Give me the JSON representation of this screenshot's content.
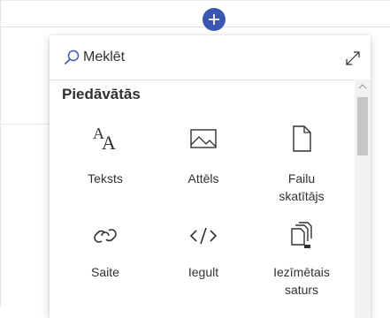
{
  "search": {
    "placeholder": "Meklēt"
  },
  "section": {
    "title": "Piedāvātās"
  },
  "tiles": [
    {
      "label": "Teksts",
      "icon": "text-icon"
    },
    {
      "label": "Attēls",
      "icon": "image-icon"
    },
    {
      "label": "Failu skatītājs",
      "icon": "file-viewer-icon"
    },
    {
      "label": "Saite",
      "icon": "link-icon"
    },
    {
      "label": "Iegult",
      "icon": "embed-icon"
    },
    {
      "label": "Iezīmētais saturs",
      "icon": "highlighted-content-icon"
    }
  ],
  "colors": {
    "accent": "#3a57b2",
    "text": "#323130",
    "icon": "#323130"
  }
}
